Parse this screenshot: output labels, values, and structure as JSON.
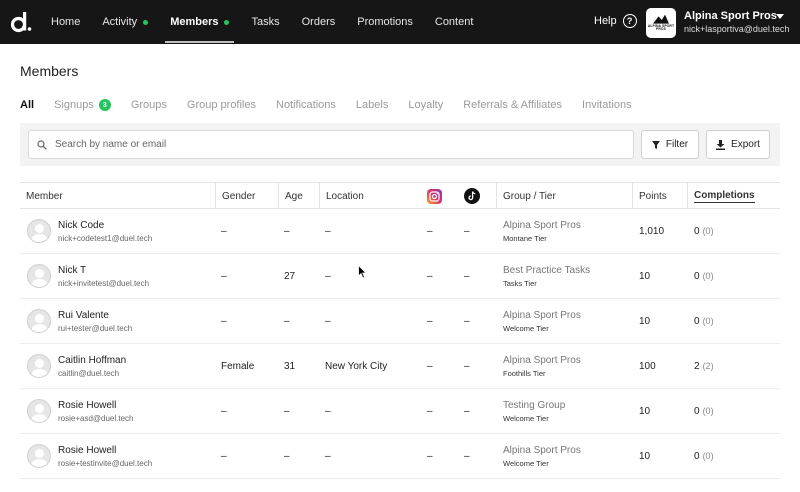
{
  "nav": {
    "logo_icon": "duel-d-logo",
    "items": [
      {
        "label": "Home",
        "active": false,
        "dot": false
      },
      {
        "label": "Activity",
        "active": false,
        "dot": true
      },
      {
        "label": "Members",
        "active": true,
        "dot": true
      },
      {
        "label": "Tasks",
        "active": false,
        "dot": false
      },
      {
        "label": "Orders",
        "active": false,
        "dot": false
      },
      {
        "label": "Promotions",
        "active": false,
        "dot": false
      },
      {
        "label": "Content",
        "active": false,
        "dot": false
      }
    ],
    "help_label": "Help",
    "account_name": "Alpina Sport Pros",
    "account_email": "nick+lasportiva@duel.tech",
    "brand_badge_text": "ALPINA SPORT PROS",
    "dot_color": "#22c55e"
  },
  "page": {
    "title": "Members",
    "subtabs": [
      {
        "label": "All",
        "active": true
      },
      {
        "label": "Signups",
        "badge": "3"
      },
      {
        "label": "Groups"
      },
      {
        "label": "Group profiles"
      },
      {
        "label": "Notifications"
      },
      {
        "label": "Labels"
      },
      {
        "label": "Loyalty"
      },
      {
        "label": "Referrals & Affiliates"
      },
      {
        "label": "Invitations"
      }
    ]
  },
  "toolbar": {
    "search_placeholder": "Search by name or email",
    "filter_label": "Filter",
    "export_label": "Export"
  },
  "table": {
    "headers": {
      "member": "Member",
      "gender": "Gender",
      "age": "Age",
      "location": "Location",
      "instagram_icon": "instagram-icon",
      "tiktok_icon": "tiktok-icon",
      "group": "Group / Tier",
      "points": "Points",
      "completions": "Completions"
    },
    "rows": [
      {
        "name": "Nick Code",
        "email": "nick+codetest1@duel.tech",
        "gender": "–",
        "age": "–",
        "location": "–",
        "ig": "–",
        "tt": "–",
        "group": "Alpina Sport Pros",
        "tier": "Montane Tier",
        "points": "1,010",
        "completions": "0",
        "completions_sub": "(0)"
      },
      {
        "name": "Nick T",
        "email": "nick+invitetest@duel.tech",
        "gender": "–",
        "age": "27",
        "location": "–",
        "ig": "–",
        "tt": "–",
        "group": "Best Practice Tasks",
        "tier": "Tasks Tier",
        "points": "10",
        "completions": "0",
        "completions_sub": "(0)"
      },
      {
        "name": "Rui Valente",
        "email": "rui+tester@duel.tech",
        "gender": "–",
        "age": "–",
        "location": "–",
        "ig": "–",
        "tt": "–",
        "group": "Alpina Sport Pros",
        "tier": "Welcome Tier",
        "points": "10",
        "completions": "0",
        "completions_sub": "(0)"
      },
      {
        "name": "Caitlin Hoffman",
        "email": "caitlin@duel.tech",
        "gender": "Female",
        "age": "31",
        "location": "New York City",
        "ig": "–",
        "tt": "–",
        "group": "Alpina Sport Pros",
        "tier": "Foothills Tier",
        "points": "100",
        "completions": "2",
        "completions_sub": "(2)"
      },
      {
        "name": "Rosie Howell",
        "email": "rosie+asd@duel.tech",
        "gender": "–",
        "age": "–",
        "location": "–",
        "ig": "–",
        "tt": "–",
        "group": "Testing Group",
        "tier": "Welcome Tier",
        "points": "10",
        "completions": "0",
        "completions_sub": "(0)"
      },
      {
        "name": "Rosie Howell",
        "email": "rosie+testinvite@duel.tech",
        "gender": "–",
        "age": "–",
        "location": "–",
        "ig": "–",
        "tt": "–",
        "group": "Alpina Sport Pros",
        "tier": "Welcome Tier",
        "points": "10",
        "completions": "0",
        "completions_sub": "(0)"
      }
    ]
  }
}
